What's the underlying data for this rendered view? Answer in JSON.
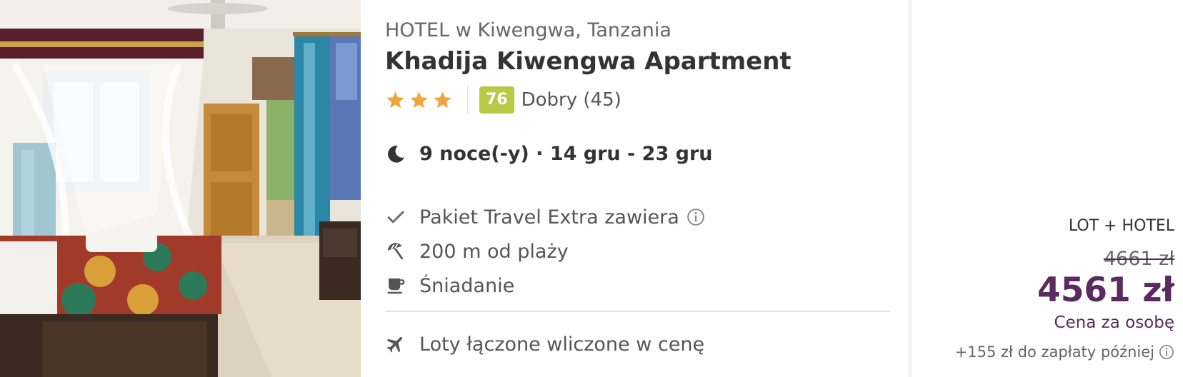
{
  "hotel": {
    "location": "HOTEL w Kiwengwa, Tanzania",
    "name": "Khadija Kiwengwa Apartment",
    "stars": 3,
    "score": "76",
    "review_text": "Dobry (45)"
  },
  "stay": {
    "dates": "9 noce(-y) · 14 gru - 23 gru"
  },
  "features": [
    {
      "icon": "check-icon",
      "label": "Pakiet Travel Extra zawiera"
    },
    {
      "icon": "beach-umbrella-icon",
      "label": "200 m od plaży"
    },
    {
      "icon": "coffee-cup-icon",
      "label": "Śniadanie"
    }
  ],
  "flights": {
    "icon": "airplane-icon",
    "label": "Loty łączone wliczone w cenę"
  },
  "price": {
    "package_type": "LOT + HOTEL",
    "old_price": "4661 zł",
    "new_price": "4561 zł",
    "per_person": "Cena za osobę",
    "later_fee": "+155 zł do zapłaty później"
  },
  "colors": {
    "brand_purple": "#5a2a60",
    "star": "#f0a53a",
    "score_badge": "#b9c845"
  }
}
